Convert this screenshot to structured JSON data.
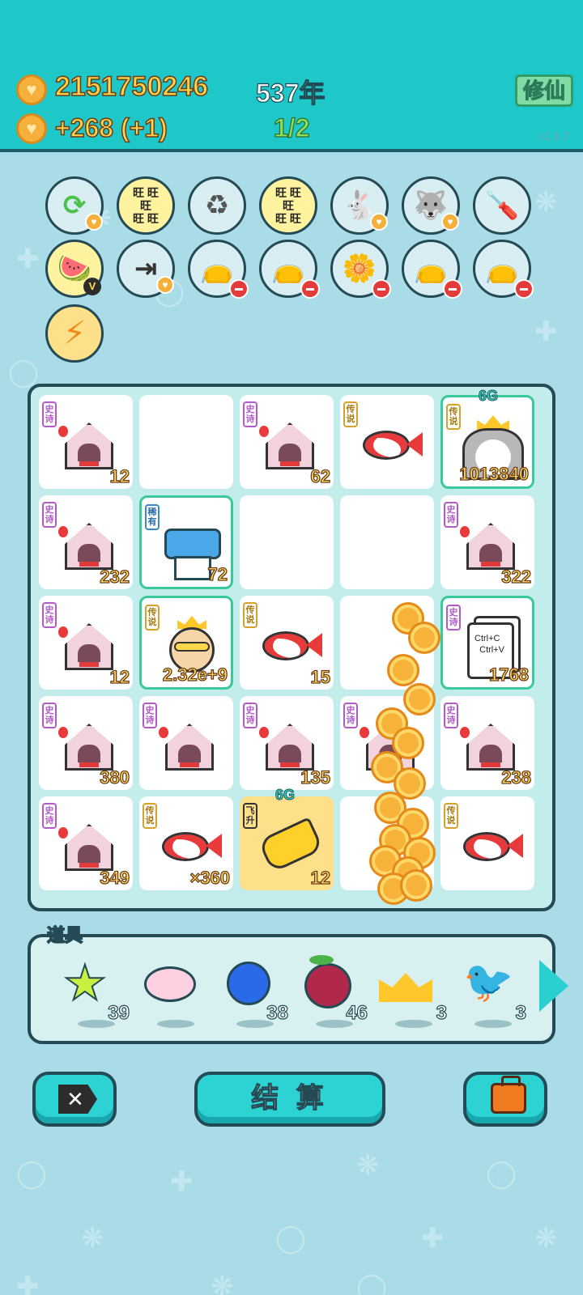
{
  "header": {
    "coins": "2151750246",
    "income": "+268 (+1)",
    "year": "537年",
    "progress": "1/2",
    "cultivate_label": "修仙",
    "version": "v1.9.7"
  },
  "skills_row1": [
    {
      "icon": "refresh-icon"
    },
    {
      "icon": "wang-grid-icon",
      "text": "旺旺\n旺\n旺旺"
    },
    {
      "icon": "trash-bag-icon"
    },
    {
      "icon": "wang-grid-icon",
      "text": "旺旺\n旺\n旺旺"
    },
    {
      "icon": "rabbit-icon"
    },
    {
      "icon": "husky-icon"
    },
    {
      "icon": "screwdriver-icon"
    }
  ],
  "skills_row2": [
    {
      "icon": "fruit-bowl-icon"
    },
    {
      "icon": "skip-icon"
    },
    {
      "icon": "bag-icon"
    },
    {
      "icon": "bag-icon"
    },
    {
      "icon": "flower-pot-icon"
    },
    {
      "icon": "bag-icon"
    },
    {
      "icon": "bag-icon"
    }
  ],
  "board": {
    "cells": [
      {
        "tag": "史诗",
        "count": "12",
        "art": "rabbit-house"
      },
      {
        "tag": "",
        "count": "",
        "art": ""
      },
      {
        "tag": "史诗",
        "count": "62",
        "art": "rabbit-house"
      },
      {
        "tag": "传说",
        "count": "",
        "art": "koi-fish"
      },
      {
        "tag": "传说",
        "count": "1013840",
        "art": "husky-king",
        "badge": "6G"
      },
      {
        "tag": "史诗",
        "count": "232",
        "art": "rabbit-house"
      },
      {
        "tag": "稀有",
        "count": "72",
        "art": "printer"
      },
      {
        "tag": "",
        "count": "",
        "art": ""
      },
      {
        "tag": "",
        "count": "",
        "art": ""
      },
      {
        "tag": "史诗",
        "count": "322",
        "art": "rabbit-house"
      },
      {
        "tag": "史诗",
        "count": "12",
        "art": "rabbit-house"
      },
      {
        "tag": "传说",
        "count": "2.32e+9",
        "art": "old-king"
      },
      {
        "tag": "传说",
        "count": "15",
        "art": "koi-fish"
      },
      {
        "tag": "",
        "count": "",
        "art": "coins"
      },
      {
        "tag": "史诗",
        "count": "1768",
        "art": "ctrl-cv",
        "ctrl_c": "Ctrl+C",
        "ctrl_v": "Ctrl+V"
      },
      {
        "tag": "史诗",
        "count": "380",
        "art": "rabbit-house"
      },
      {
        "tag": "史诗",
        "count": "",
        "art": "rabbit-house"
      },
      {
        "tag": "史诗",
        "count": "135",
        "art": "rabbit-house"
      },
      {
        "tag": "史诗",
        "count": "",
        "art": "rabbit-house"
      },
      {
        "tag": "史诗",
        "count": "238",
        "art": "rabbit-house"
      },
      {
        "tag": "史诗",
        "count": "349",
        "art": "rabbit-house"
      },
      {
        "tag": "传说",
        "count": "×360",
        "art": "koi-fish"
      },
      {
        "tag": "飞升",
        "count": "12",
        "art": "pointing-hand",
        "badge": "6G"
      },
      {
        "tag": "",
        "count": "",
        "art": "coins"
      },
      {
        "tag": "传说",
        "count": "",
        "art": "koi-fish"
      }
    ]
  },
  "items": {
    "label": "道具",
    "list": [
      {
        "icon": "star-icon",
        "count": "39"
      },
      {
        "icon": "piggy-bank-icon",
        "count": ""
      },
      {
        "icon": "blueberry-icon",
        "count": "38"
      },
      {
        "icon": "bayberry-icon",
        "count": "46"
      },
      {
        "icon": "crown-icon",
        "count": "3"
      },
      {
        "icon": "duck-icon",
        "count": "3"
      }
    ]
  },
  "buttons": {
    "settle": "结 算"
  },
  "colors": {
    "header": "#1ec8c8",
    "background": "#a9dce6",
    "coin": "#f4b03a",
    "epic_tag": "#b25ac8",
    "legend_tag": "#d8a22a"
  }
}
